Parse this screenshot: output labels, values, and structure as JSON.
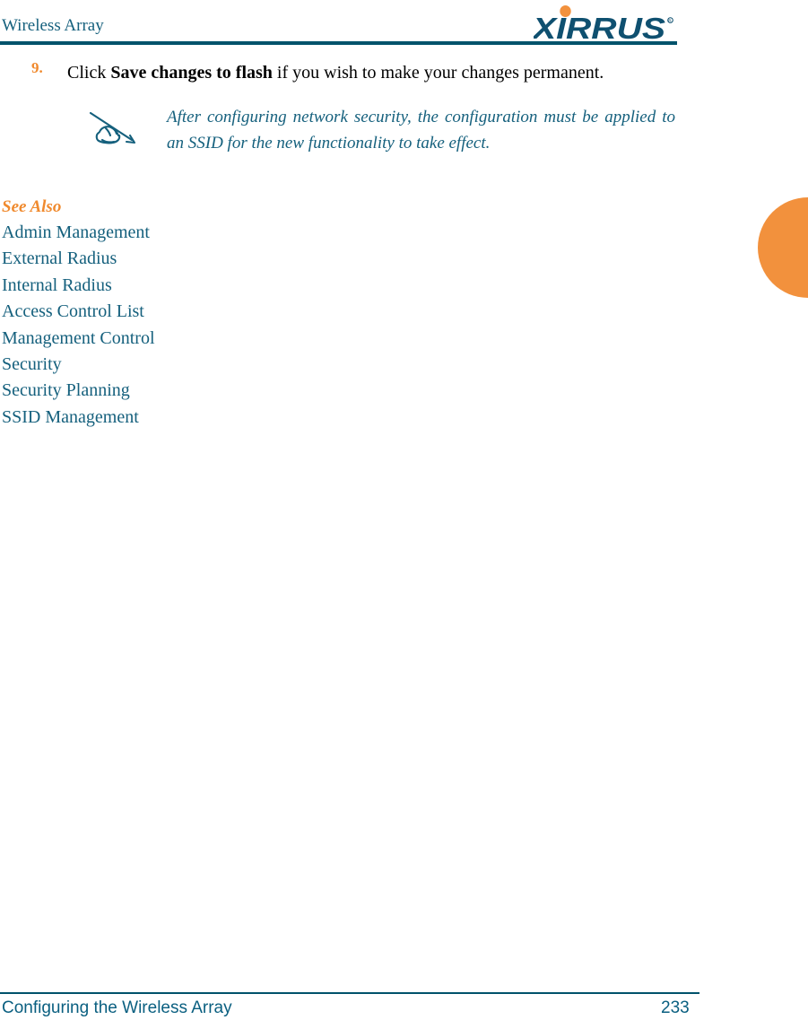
{
  "header": {
    "title": "Wireless Array",
    "logo_text": "XIRRUS",
    "logo_trademark": "®",
    "logo_color": "#0f5070",
    "logo_dot_color": "#f2913d",
    "rule_color": "#00526b"
  },
  "edge_tab": {
    "color": "#f2913d"
  },
  "step": {
    "number": "9.",
    "number_color": "#f08a2e",
    "text_before": "Click ",
    "bold_text": "Save changes to flash",
    "text_after": " if you wish to make your changes permanent."
  },
  "note": {
    "icon": "hand-writing-pen-icon",
    "icon_color": "#15607d",
    "text": "After configuring network security, the configuration must be applied to an SSID for the new functionality to take effect.",
    "text_color": "#15607d"
  },
  "see_also": {
    "title": "See Also",
    "title_color": "#f08a2e",
    "link_color": "#15607d",
    "items": [
      "Admin Management",
      "External Radius",
      "Internal Radius",
      "Access Control List",
      "Management Control",
      "Security",
      "Security Planning",
      "SSID Management"
    ]
  },
  "footer": {
    "left_text": "Configuring the Wireless Array",
    "page_number": "233",
    "rule_color": "#00526b",
    "text_color": "#0a5f80"
  }
}
